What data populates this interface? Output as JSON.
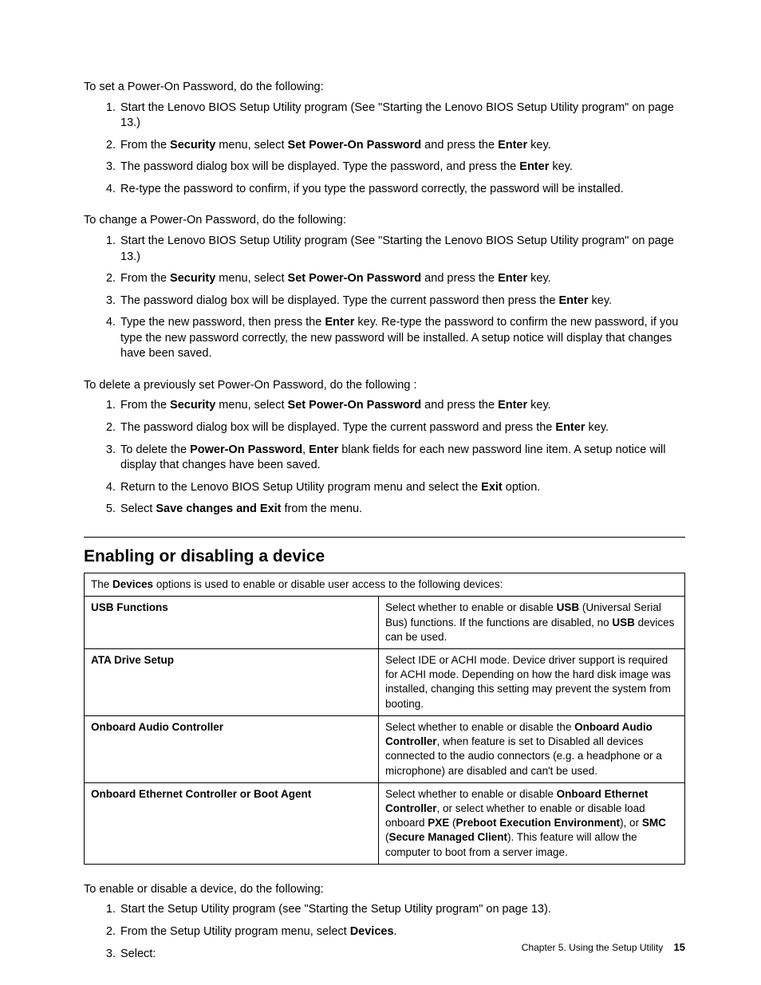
{
  "section1": {
    "intro": "To set a Power-On Password, do the following:",
    "items": [
      {
        "pre": "Start the Lenovo BIOS Setup Utility program (See \"Starting the Lenovo BIOS Setup Utility program\" on page 13.)"
      },
      {
        "pre": "From the ",
        "b1": "Security",
        "mid1": " menu, select ",
        "b2": "Set Power-On Password",
        "mid2": " and press the ",
        "b3": "Enter",
        "post": " key."
      },
      {
        "pre": "The password dialog box will be displayed. Type the password, and press the ",
        "b1": "Enter",
        "post": " key."
      },
      {
        "pre": "Re-type the password to confirm, if you type the password correctly, the password will be installed."
      }
    ]
  },
  "section2": {
    "intro": "To change a Power-On Password, do the following:",
    "items": [
      {
        "pre": "Start the Lenovo BIOS Setup Utility program (See \"Starting the Lenovo BIOS Setup Utility program\" on page 13.)"
      },
      {
        "pre": "From the ",
        "b1": "Security",
        "mid1": " menu, select ",
        "b2": "Set Power-On Password",
        "mid2": " and press the ",
        "b3": "Enter",
        "post": " key."
      },
      {
        "pre": "The password dialog box will be displayed. Type the current password then press the ",
        "b1": "Enter",
        "post": " key."
      },
      {
        "pre": "Type the new password, then press the ",
        "b1": "Enter",
        "post": " key. Re-type the password to confirm the new password, if you type the new password correctly, the new password will be installed. A setup notice will display that changes have been saved."
      }
    ]
  },
  "section3": {
    "intro": "To delete a previously set Power-On Password, do the following :",
    "items": [
      {
        "pre": "From the ",
        "b1": "Security",
        "mid1": " menu, select ",
        "b2": "Set Power-On Password",
        "mid2": " and press the ",
        "b3": "Enter",
        "post": " key."
      },
      {
        "pre": "The password dialog box will be displayed. Type the current password and press the ",
        "b1": "Enter",
        "post": " key."
      },
      {
        "pre": "To delete the ",
        "b1": "Power-On Password",
        "mid1": ", ",
        "b2": "Enter",
        "post": " blank fields for each new password line item. A setup notice will display that changes have been saved."
      },
      {
        "pre": "Return to the Lenovo BIOS Setup Utility program menu and select the ",
        "b1": "Exit",
        "post": " option."
      },
      {
        "pre": "Select ",
        "b1": "Save changes and Exit",
        "post": " from the menu."
      }
    ]
  },
  "heading": "Enabling or disabling a device",
  "tableHeader": {
    "pre": "The ",
    "b1": "Devices",
    "post": " options is used to enable or disable user access to the following devices:"
  },
  "tableRows": [
    {
      "left": "USB Functions",
      "right": {
        "t1": "Select whether to enable or disable ",
        "b1": "USB",
        "t2": " (Universal Serial Bus) functions. If the functions are disabled, no ",
        "b2": "USB",
        "t3": " devices can be used."
      }
    },
    {
      "left": "ATA Drive Setup",
      "right": {
        "t1": "Select IDE or ACHI mode. Device driver support is required for ACHI mode. Depending on how the hard disk image was installed, changing this setting may prevent the system from booting."
      }
    },
    {
      "left": "Onboard Audio Controller",
      "right": {
        "t1": "Select whether to enable or disable the ",
        "b1": "Onboard Audio Controller",
        "t2": ", when feature is set to Disabled all devices connected to the audio connectors (e.g. a headphone or a microphone) are disabled and can't be used."
      }
    },
    {
      "left": "Onboard Ethernet Controller or Boot Agent",
      "right": {
        "t1": "Select whether to enable or disable ",
        "b1": "Onboard Ethernet Controller",
        "t2": ", or select whether to enable or disable load onboard ",
        "b2": "PXE",
        "t3": " (",
        "b3": "Preboot Execution Environment",
        "t4": "), or ",
        "b4": "SMC",
        "t5": " (",
        "b5": "Secure Managed Client",
        "t6": "). This feature will allow the computer to boot from a server image."
      }
    }
  ],
  "section4": {
    "intro": "To enable or disable a device, do the following:",
    "items": [
      {
        "pre": "Start the Setup Utility program (see \"Starting the Setup Utility program\" on page 13)."
      },
      {
        "pre": "From the Setup Utility program menu, select ",
        "b1": "Devices",
        "post": "."
      },
      {
        "pre": "Select:"
      }
    ]
  },
  "footer": {
    "chapter": "Chapter 5. Using the Setup Utility",
    "page": "15"
  }
}
